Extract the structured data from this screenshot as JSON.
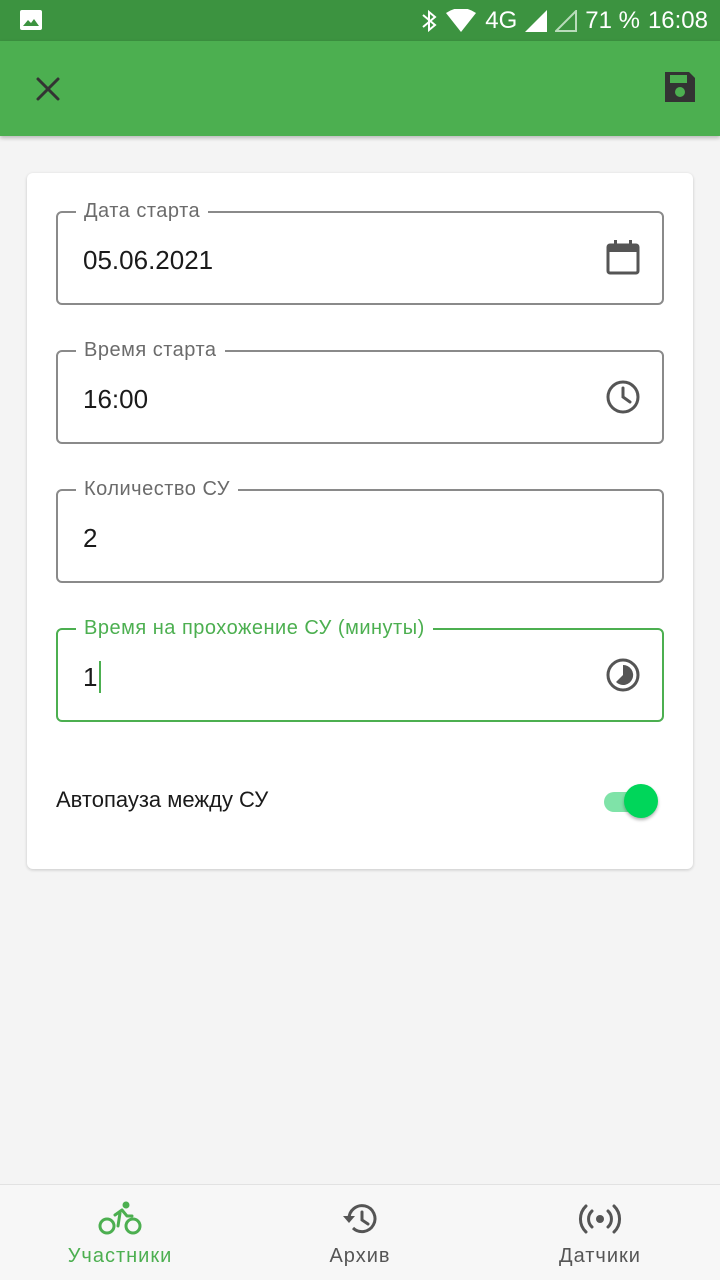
{
  "status_bar": {
    "network": "4G",
    "battery": "71 %",
    "time": "16:08"
  },
  "app_bar": {
    "close_icon": "close-icon",
    "save_icon": "save-icon"
  },
  "form": {
    "start_date": {
      "label": "Дата старта",
      "value": "05.06.2021",
      "icon": "calendar-icon"
    },
    "start_time": {
      "label": "Время старта",
      "value": "16:00",
      "icon": "clock-icon"
    },
    "su_count": {
      "label": "Количество СУ",
      "value": "2"
    },
    "su_duration": {
      "label": "Время на прохожение СУ (минуты)",
      "value": "1",
      "icon": "timelapse-icon"
    },
    "autopause": {
      "label": "Автопауза между СУ",
      "enabled": true
    }
  },
  "bottom_nav": {
    "items": [
      {
        "label": "Участники",
        "icon": "bike-icon",
        "active": true
      },
      {
        "label": "Архив",
        "icon": "history-icon",
        "active": false
      },
      {
        "label": "Датчики",
        "icon": "broadcast-icon",
        "active": false
      }
    ]
  },
  "colors": {
    "primary": "#4caf50",
    "primary_dark": "#3c9340",
    "switch_on": "#00d65a"
  }
}
